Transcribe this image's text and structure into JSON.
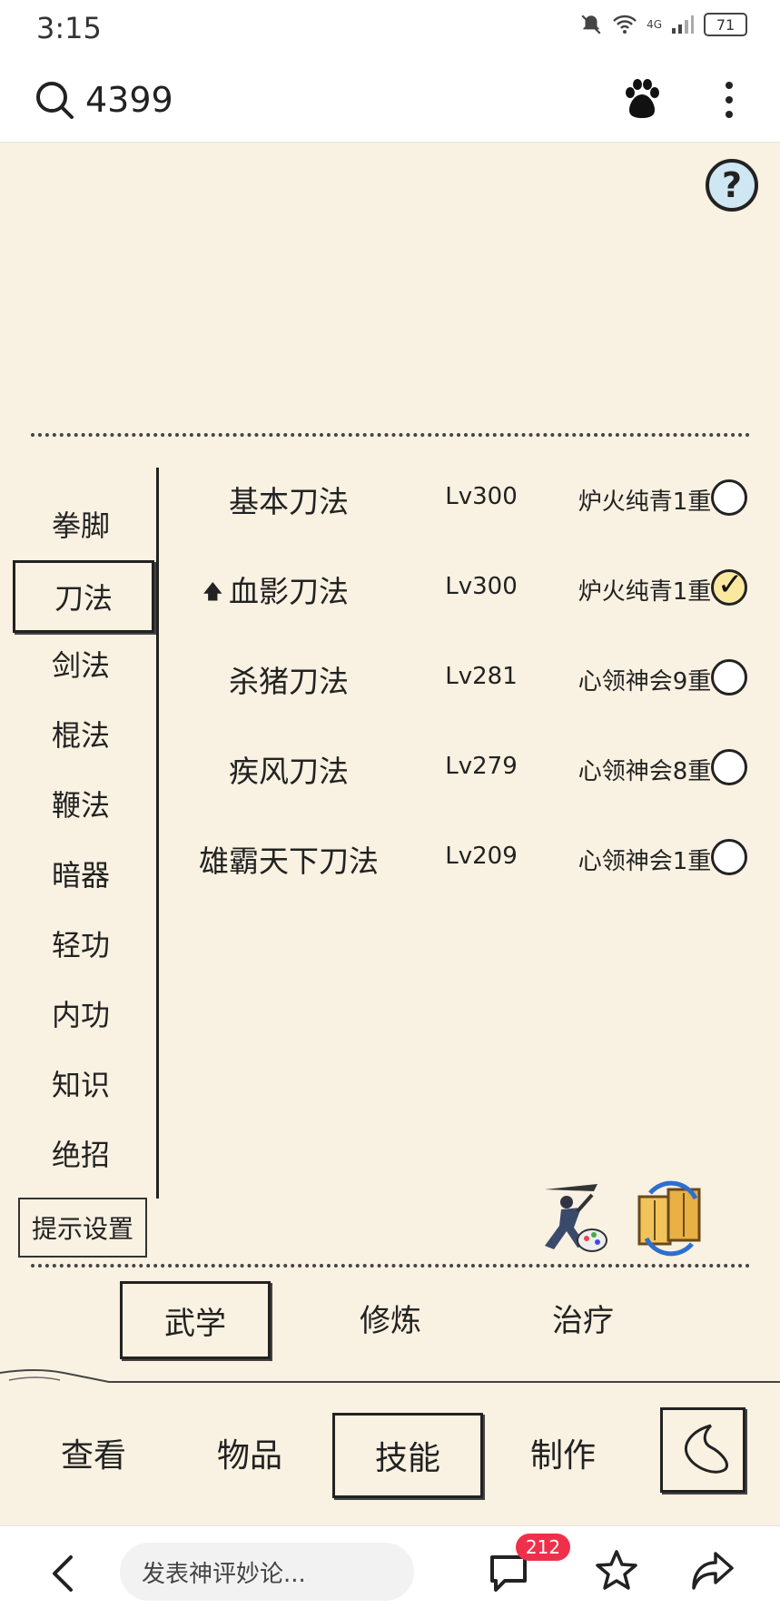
{
  "status_bar": {
    "time": "3:15",
    "network": "4G",
    "battery": "71"
  },
  "browser": {
    "search_query": "4399"
  },
  "game": {
    "help_label": "?",
    "sidebar": {
      "items": [
        {
          "label": "拳脚",
          "active": false
        },
        {
          "label": "刀法",
          "active": true
        },
        {
          "label": "剑法",
          "active": false
        },
        {
          "label": "棍法",
          "active": false
        },
        {
          "label": "鞭法",
          "active": false
        },
        {
          "label": "暗器",
          "active": false
        },
        {
          "label": "轻功",
          "active": false
        },
        {
          "label": "内功",
          "active": false
        },
        {
          "label": "知识",
          "active": false
        },
        {
          "label": "绝招",
          "active": false
        }
      ],
      "hint_settings": "提示设置"
    },
    "skills": [
      {
        "name": "基本刀法",
        "level": "Lv300",
        "rank": "炉火纯青1重",
        "selected": false,
        "upgrade_marker": false
      },
      {
        "name": "血影刀法",
        "level": "Lv300",
        "rank": "炉火纯青1重",
        "selected": true,
        "upgrade_marker": true
      },
      {
        "name": "杀猪刀法",
        "level": "Lv281",
        "rank": "心领神会9重",
        "selected": false,
        "upgrade_marker": false
      },
      {
        "name": "疾风刀法",
        "level": "Lv279",
        "rank": "心领神会8重",
        "selected": false,
        "upgrade_marker": false
      },
      {
        "name": "雄霸天下刀法",
        "level": "Lv209",
        "rank": "心领神会1重",
        "selected": false,
        "upgrade_marker": false
      }
    ],
    "sub_tabs": [
      {
        "label": "武学",
        "active": true
      },
      {
        "label": "修炼",
        "active": false
      },
      {
        "label": "治疗",
        "active": false
      }
    ],
    "main_tabs": [
      {
        "label": "查看",
        "active": false
      },
      {
        "label": "物品",
        "active": false
      },
      {
        "label": "技能",
        "active": true
      },
      {
        "label": "制作",
        "active": false
      }
    ]
  },
  "bottom_nav": {
    "comment_placeholder": "发表神评妙论...",
    "comment_count": "212"
  },
  "colors": {
    "game_bg": "#f9f1e1",
    "badge": "#f0304a",
    "help_circle": "#cfe7f2"
  }
}
